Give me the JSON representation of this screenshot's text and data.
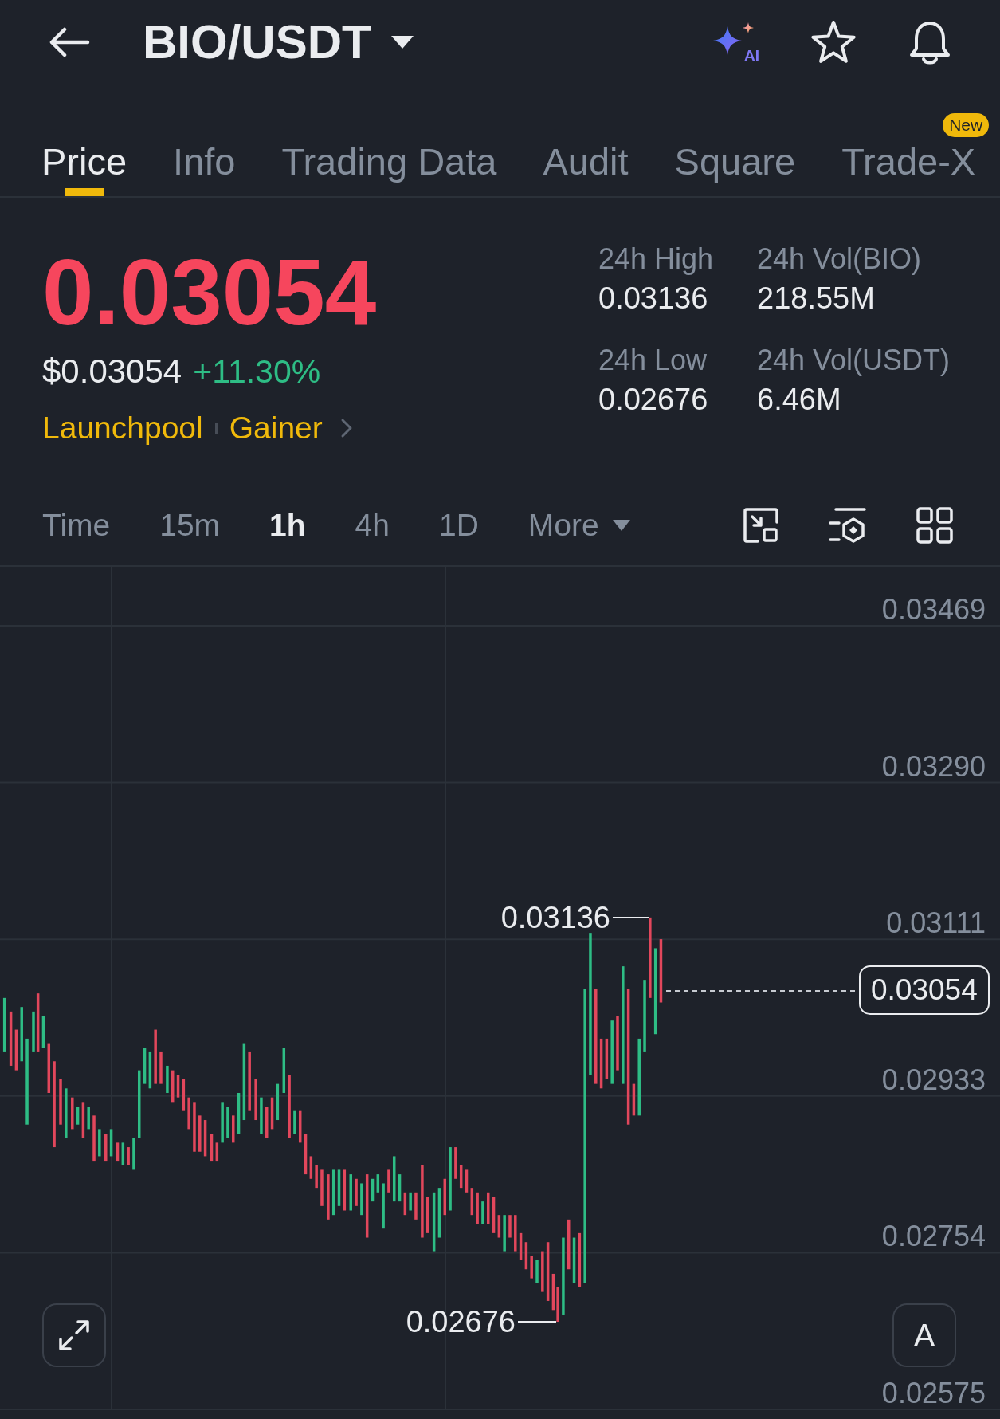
{
  "header": {
    "title": "BIO/USDT",
    "ai_label": "AI"
  },
  "tabs": [
    {
      "label": "Price",
      "selected": true
    },
    {
      "label": "Info",
      "selected": false
    },
    {
      "label": "Trading Data",
      "selected": false
    },
    {
      "label": "Audit",
      "selected": false
    },
    {
      "label": "Square",
      "selected": false
    },
    {
      "label": "Trade-X",
      "selected": false,
      "badge": "New"
    }
  ],
  "ticker": {
    "price": "0.03054",
    "price_falling": true,
    "usd_price": "$0.03054",
    "change": "+11.30%",
    "change_positive": true,
    "tags": [
      "Launchpool",
      "Gainer"
    ]
  },
  "stats": [
    {
      "label": "24h High",
      "value": "0.03136"
    },
    {
      "label": "24h Vol(BIO)",
      "value": "218.55M"
    },
    {
      "label": "24h Low",
      "value": "0.02676"
    },
    {
      "label": "24h Vol(USDT)",
      "value": "6.46M"
    }
  ],
  "intervals": [
    {
      "label": "Time",
      "kind": "option",
      "selected": false
    },
    {
      "label": "15m",
      "kind": "option",
      "selected": false
    },
    {
      "label": "1h",
      "kind": "option",
      "selected": true
    },
    {
      "label": "4h",
      "kind": "option",
      "selected": false
    },
    {
      "label": "1D",
      "kind": "option",
      "selected": false
    },
    {
      "label": "More",
      "kind": "menu",
      "selected": false
    }
  ],
  "chart": {
    "y_labels": [
      "0.03469",
      "0.03290",
      "0.03111",
      "0.02933",
      "0.02754",
      "0.02575"
    ],
    "high_label": "0.03136",
    "low_label": "0.02676",
    "last_price": "0.03054",
    "scale_button": "A"
  }
}
